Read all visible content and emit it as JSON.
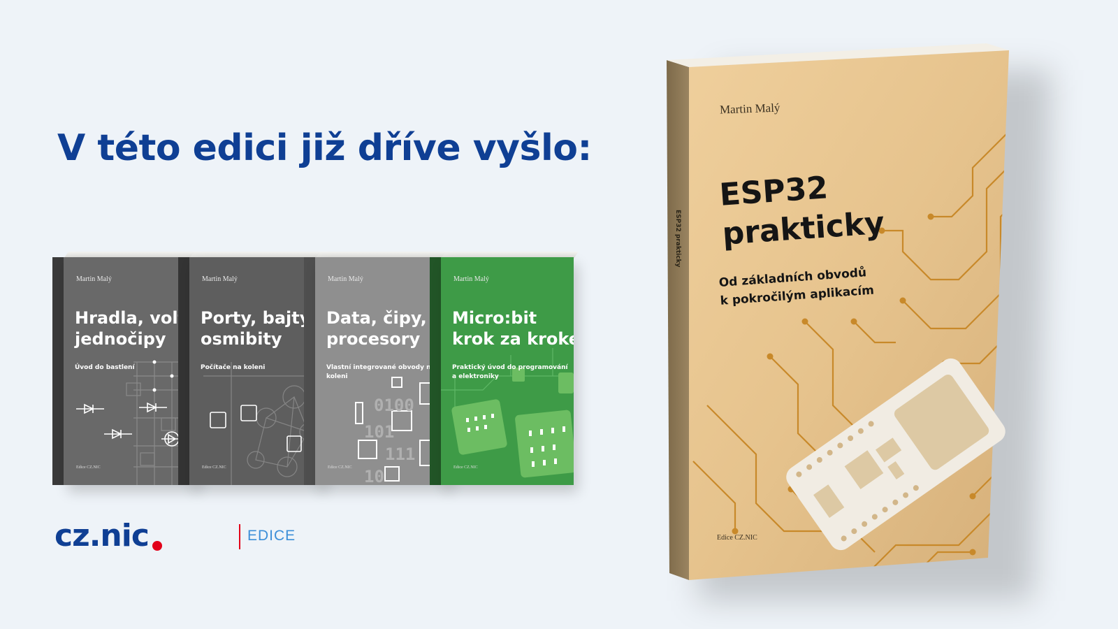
{
  "headline": "V této edici již dříve vyšlo:",
  "books": [
    {
      "author": "Martin Malý",
      "title": "Hradla, volty,\njednočipy",
      "subtitle": "Úvod do bastlení",
      "edition": "Edice CZ.NIC",
      "color": "#696969"
    },
    {
      "author": "Martin Malý",
      "title": "Porty, bajty,\nosmibity",
      "subtitle": "Počítače na koleni",
      "edition": "Edice CZ.NIC",
      "color": "#5e5e5e"
    },
    {
      "author": "Martin Malý",
      "title": "Data, čipy,\nprocesory",
      "subtitle": "Vlastní integrované obvody na koleni",
      "edition": "Edice CZ.NIC",
      "color": "#8f8f8f"
    },
    {
      "author": "Martin Malý",
      "title": "Micro:bit\nkrok za krokem",
      "subtitle": "Praktický úvod do programování\na elektroniky",
      "edition": "Edice CZ.NIC",
      "color": "#3e9b47"
    }
  ],
  "logo": {
    "mark": "cz.nic",
    "label": "EDICE",
    "primary_color": "#0f3f94",
    "accent_color": "#e2001a",
    "label_color": "#3d8fd8"
  },
  "featured_book": {
    "author": "Martin Malý",
    "title": "ESP32\nprakticky",
    "subtitle": "Od základních obvodů\nk pokročilým aplikacím",
    "edition": "Edice CZ.NIC",
    "spine_title": "ESP32 prakticky",
    "color": "#e6c38d",
    "art_icon": "esp32-board-icon"
  },
  "colors": {
    "background": "#eef3f8",
    "headline": "#0f3f94"
  }
}
